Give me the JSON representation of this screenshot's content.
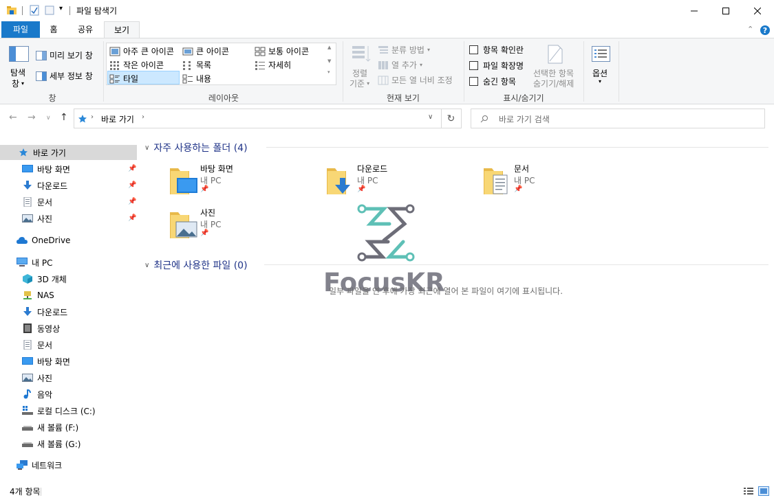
{
  "window": {
    "title": "파일 탐색기",
    "controls": {
      "minimize": "minimize-icon",
      "maximize": "maximize-icon",
      "close": "close-icon"
    }
  },
  "tabs": [
    {
      "label": "파일"
    },
    {
      "label": "홈"
    },
    {
      "label": "공유"
    },
    {
      "label": "보기"
    }
  ],
  "ribbon": {
    "pane": {
      "nav_pane_line1": "탐색",
      "nav_pane_line2": "창",
      "preview_pane": "미리 보기 창",
      "details_pane": "세부 정보 창",
      "group_label": "창"
    },
    "layout": {
      "items": [
        "아주 큰 아이콘",
        "큰 아이콘",
        "보통 아이콘",
        "작은 아이콘",
        "목록",
        "자세히",
        "타일",
        "내용"
      ],
      "selected": "타일",
      "group_label": "레이아웃"
    },
    "current_view": {
      "sort_line1": "정렬",
      "sort_line2": "기준",
      "group_by": "분류 방법",
      "add_columns": "열 추가",
      "size_columns": "모든 열 너비 조정",
      "group_label": "현재 보기"
    },
    "show_hide": {
      "item_checkboxes": "항목 확인란",
      "file_extensions": "파일 확장명",
      "hidden_items": "숨긴 항목",
      "hide_selected_line1": "선택한 항목",
      "hide_selected_line2": "숨기기/해제",
      "group_label": "표시/숨기기"
    },
    "options": {
      "label": "옵션"
    }
  },
  "address": {
    "path": "바로 가기",
    "search_placeholder": "바로 가기 검색"
  },
  "nav": {
    "quick_access": "바로 가기",
    "quick_items": [
      "바탕 화면",
      "다운로드",
      "문서",
      "사진"
    ],
    "onedrive": "OneDrive",
    "this_pc": "내 PC",
    "pc_items": [
      "3D 개체",
      "NAS",
      "다운로드",
      "동영상",
      "문서",
      "바탕 화면",
      "사진",
      "음악",
      "로컬 디스크 (C:)",
      "새 볼륨 (F:)",
      "새 볼륨 (G:)"
    ],
    "network": "네트워크"
  },
  "content": {
    "frequent_header": "자주 사용하는 폴더 (4)",
    "folders": [
      {
        "name": "바탕 화면",
        "location": "내 PC"
      },
      {
        "name": "다운로드",
        "location": "내 PC"
      },
      {
        "name": "문서",
        "location": "내 PC"
      },
      {
        "name": "사진",
        "location": "내 PC"
      }
    ],
    "recent_header": "최근에 사용한 파일 (0)",
    "recent_empty": "일부 파일을 연 후에 가장 최근에 열어 본 파일이 여기에 표시됩니다."
  },
  "watermark": "FocusKR",
  "status": {
    "count": "4개 항목"
  },
  "colors": {
    "accent": "#1979ca",
    "selected": "#cce8ff",
    "header": "#1e3287",
    "folder": "#f8d775"
  }
}
